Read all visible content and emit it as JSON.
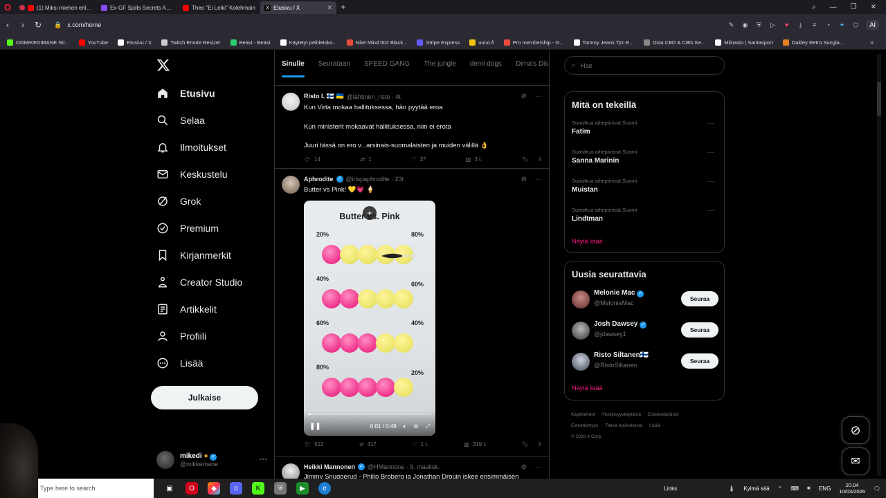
{
  "browser": {
    "tabs": [
      {
        "label": "(1) Miksi miehen erilaisuu",
        "color": "#ff0000"
      },
      {
        "label": "Ex-GF Spills Secrets About",
        "color": "#9146ff"
      },
      {
        "label": "Theo \"Ei Leiki\" Kolehmain",
        "color": "#ff0000"
      },
      {
        "label": "Etusivu / X",
        "color": "#ffffff"
      }
    ],
    "url": "x.com/home",
    "ai_label": "AI",
    "bookmarks": [
      {
        "label": "OGMIKEDIMANE Str...",
        "color": "#53fc18"
      },
      {
        "label": "YouTube",
        "color": "#ff0000"
      },
      {
        "label": "Etusivu / X",
        "color": "#ffffff"
      },
      {
        "label": "Twitch Emote Resizer",
        "color": "#cccccc"
      },
      {
        "label": "Beast - Beast",
        "color": "#2ecc71"
      },
      {
        "label": "Käytetyt pelitietoko...",
        "color": "#ffffff"
      },
      {
        "label": "Nike Mind 002 Black...",
        "color": "#e74c3c"
      },
      {
        "label": "Stripe Express",
        "color": "#635bff"
      },
      {
        "label": "uuno.fi",
        "color": "#f1c40f"
      },
      {
        "label": "Pro membership - G...",
        "color": "#e74c3c"
      },
      {
        "label": "Tommy Jeans Tjm E...",
        "color": "#ffffff"
      },
      {
        "label": "Osta CBD & CBG Ke...",
        "color": "#888888"
      },
      {
        "label": "Miinasto | Santasport",
        "color": "#ffffff"
      },
      {
        "label": "Oakley Retro Sungla...",
        "color": "#e67e22"
      }
    ]
  },
  "nav": {
    "items": [
      {
        "label": "Etusivu",
        "icon": "home-icon"
      },
      {
        "label": "Selaa",
        "icon": "search-icon"
      },
      {
        "label": "Ilmoitukset",
        "icon": "bell-icon"
      },
      {
        "label": "Keskustelu",
        "icon": "mail-icon"
      },
      {
        "label": "Grok",
        "icon": "grok-icon"
      },
      {
        "label": "Premium",
        "icon": "premium-icon"
      },
      {
        "label": "Kirjanmerkit",
        "icon": "bookmark-icon"
      },
      {
        "label": "Creator Studio",
        "icon": "creator-icon"
      },
      {
        "label": "Artikkelit",
        "icon": "article-icon"
      },
      {
        "label": "Profiili",
        "icon": "profile-icon"
      },
      {
        "label": "Lisää",
        "icon": "more-icon"
      }
    ],
    "post_label": "Julkaise",
    "account_name": "mikedi",
    "account_handle": "@mikkemane"
  },
  "timeline": {
    "tabs": [
      "Sinulle",
      "Seurataan",
      "SPEED GANG",
      "The jungle",
      "demi dogs",
      "Dima's Dist"
    ],
    "tweets": [
      {
        "name": "Risto L 🇫🇮 🇺🇦",
        "meta": "@lahtinen_risto · 4t",
        "lines": [
          "Kun Virta mokaa hallituksessa, hän pyytää eroa",
          "Kun ministerit mokaavat hallituksessa, niin ei erota",
          "Juuri tässä on ero v...arsinais-suomalaisten ja muiden välillä 👌"
        ],
        "replies": "14",
        "reposts": "1",
        "likes": "37",
        "views": "3 t."
      },
      {
        "name": "Aphrodite",
        "meta": "@irispaphrodite · 23t",
        "lines": [
          "Butter vs Pink! 💛💗 🍦"
        ],
        "video": {
          "title": "Butter vs. Pink",
          "rows": [
            {
              "left": "20%",
              "right": "80%",
              "pink": 1
            },
            {
              "left": "40%",
              "right": "60%",
              "pink": 2
            },
            {
              "left": "60%",
              "right": "40%",
              "pink": 3
            },
            {
              "left": "80%",
              "right": "20%",
              "pink": 4
            }
          ],
          "time": "0:01 / 0:49",
          "progress": 0.02
        },
        "replies": "512",
        "reposts": "417",
        "likes": "1 t.",
        "views": "319 t."
      },
      {
        "name": "Heikki Mannonen",
        "meta": "@HMannone · 9. maalisk.",
        "lines": [
          "Jimmy Snuggerud - Philip Broberg ja Jonathan Drouin iskee ensimmäisen"
        ]
      }
    ]
  },
  "right": {
    "search_placeholder": "Hae",
    "trends_title": "Mitä on tekeillä",
    "trends": [
      {
        "meta": "Suosittua aihepiirissä Suomi",
        "name": "Fatim"
      },
      {
        "meta": "Suosittua aihepiirissä Suomi",
        "name": "Sanna Marinin"
      },
      {
        "meta": "Suosittua aihepiirissä Suomi",
        "name": "Muistan"
      },
      {
        "meta": "Suosittua aihepiirissä Suomi",
        "name": "Lindtman"
      }
    ],
    "show_more": "Näytä lisää",
    "who_title": "Uusia seurattavia",
    "follows": [
      {
        "name": "Melonie Mac",
        "handle": "@MelonieMac",
        "button": "Seuraa"
      },
      {
        "name": "Josh Dawsey",
        "handle": "@jdawsey1",
        "button": "Seuraa"
      },
      {
        "name": "Risto Siltanen🇫🇮",
        "handle": "@RistoSiltanen",
        "button": "Seuraa"
      }
    ],
    "footer": [
      "Käyttöehdot",
      "Yksityisyyskäytäntö",
      "Evästekäytäntö",
      "Esteettömyys",
      "Tietoa mainoksista",
      "Lisää ···",
      "© 2026 X Corp."
    ]
  },
  "taskbar": {
    "search_placeholder": "Type here to search",
    "links": "Links",
    "weather": "Kylmä sää",
    "lang": "ENG",
    "time": "20.04",
    "date": "10/03/2026"
  },
  "colors": {
    "accent": "#1d9bf0",
    "pink": "#f91880",
    "ball_pink": "#f0388f",
    "ball_yellow": "#ece66b"
  }
}
